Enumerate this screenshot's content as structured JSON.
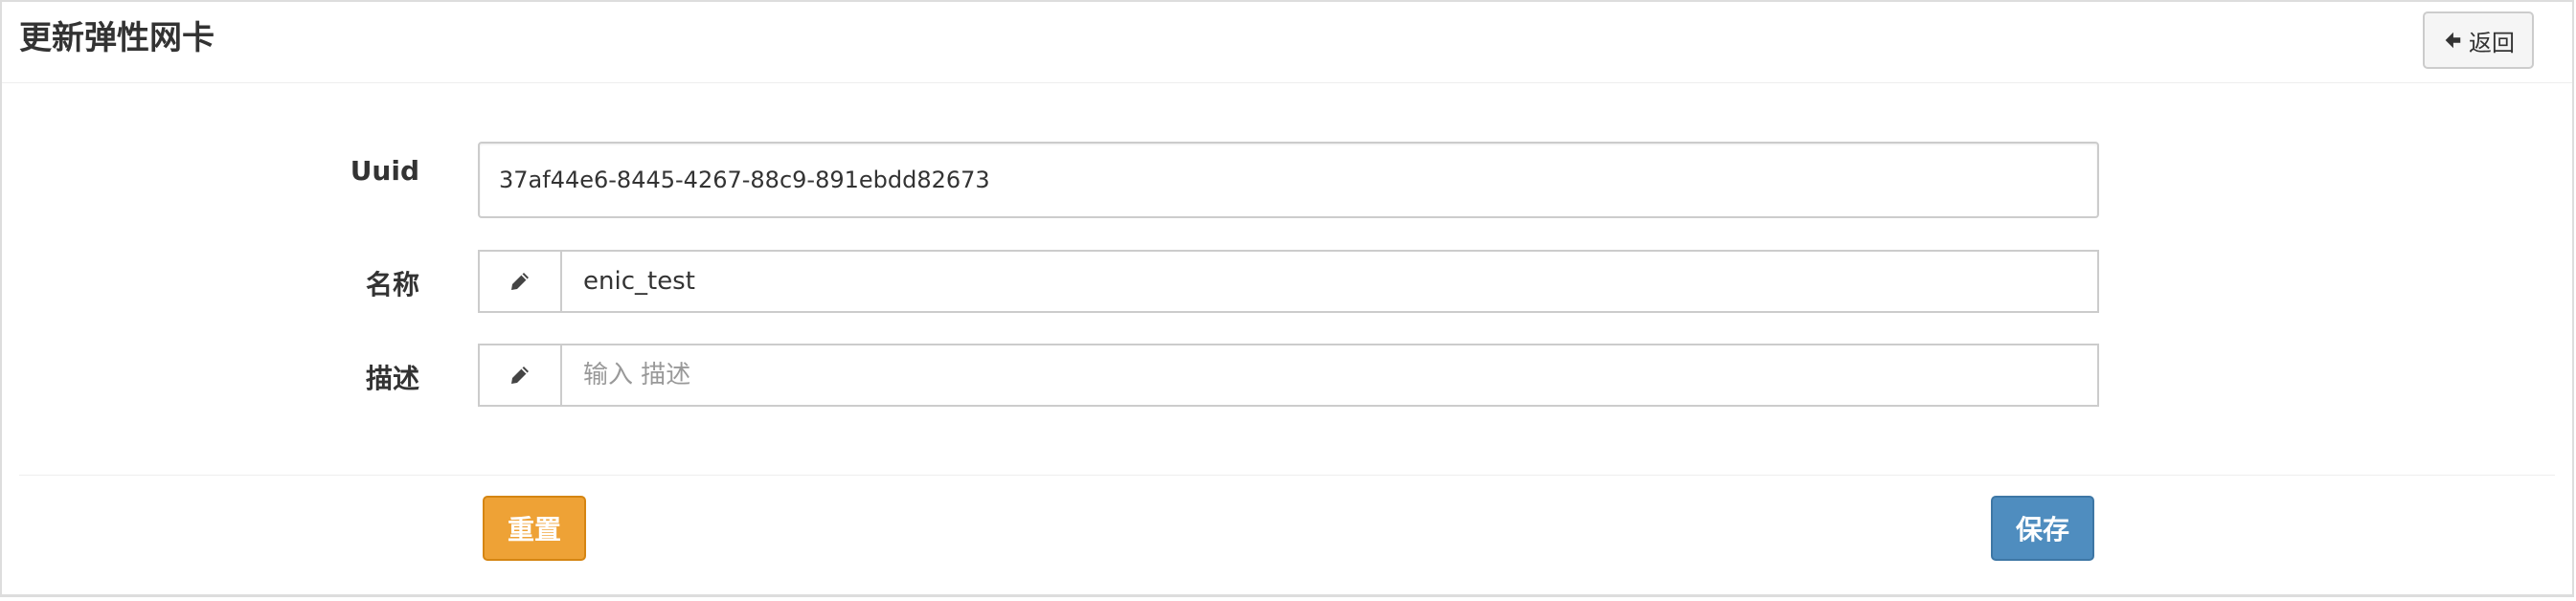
{
  "header": {
    "title": "更新弹性网卡",
    "back_label": "返回"
  },
  "form": {
    "uuid": {
      "label": "Uuid",
      "value": "37af44e6-8445-4267-88c9-891ebdd82673"
    },
    "name": {
      "label": "名称",
      "value": "enic_test",
      "placeholder": ""
    },
    "description": {
      "label": "描述",
      "value": "",
      "placeholder": "输入 描述"
    }
  },
  "footer": {
    "reset_label": "重置",
    "save_label": "保存"
  },
  "colors": {
    "reset": "#eea236",
    "save": "#4f8dbf"
  }
}
